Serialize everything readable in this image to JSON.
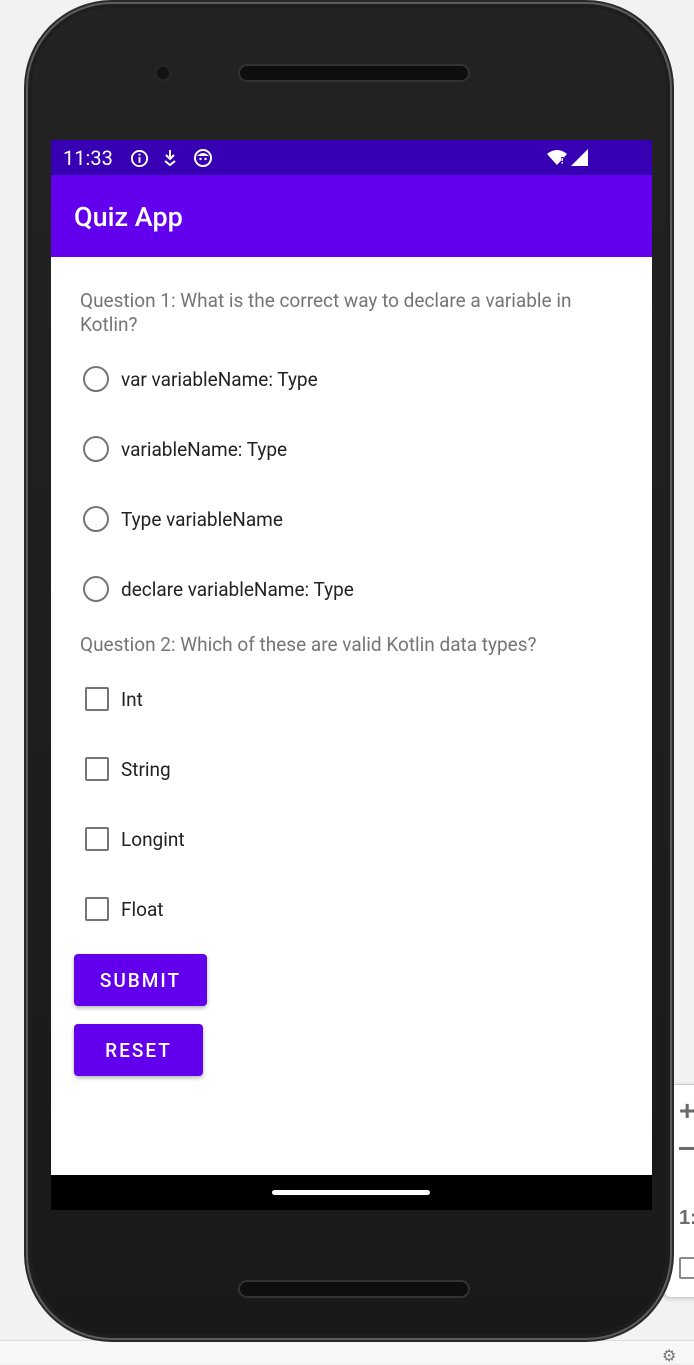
{
  "statusbar": {
    "time": "11:33",
    "icons": [
      "info-icon",
      "download-icon",
      "face-icon",
      "wifi-icon",
      "signal-icon"
    ],
    "colors": {
      "statusbar": "#3700b3",
      "appbar": "#6200ee"
    }
  },
  "appbar": {
    "title": "Quiz App"
  },
  "quiz": {
    "q1": {
      "text": "Question 1: What is the correct way to declare a variable in Kotlin?",
      "options": [
        "var variableName: Type",
        "variableName: Type",
        "Type variableName",
        "declare variableName: Type"
      ]
    },
    "q2": {
      "text": "Question 2: Which of these are valid Kotlin data types?",
      "options": [
        "Int",
        "String",
        "Longint",
        "Float"
      ]
    },
    "submit_label": "SUBMIT",
    "reset_label": "RESET"
  },
  "emulator_toolbar": {
    "icons": [
      "zoom-in-icon",
      "zoom-out-icon",
      "one-to-one-icon",
      "frame-icon",
      "settings-icon"
    ],
    "ratio_label": "1:"
  }
}
